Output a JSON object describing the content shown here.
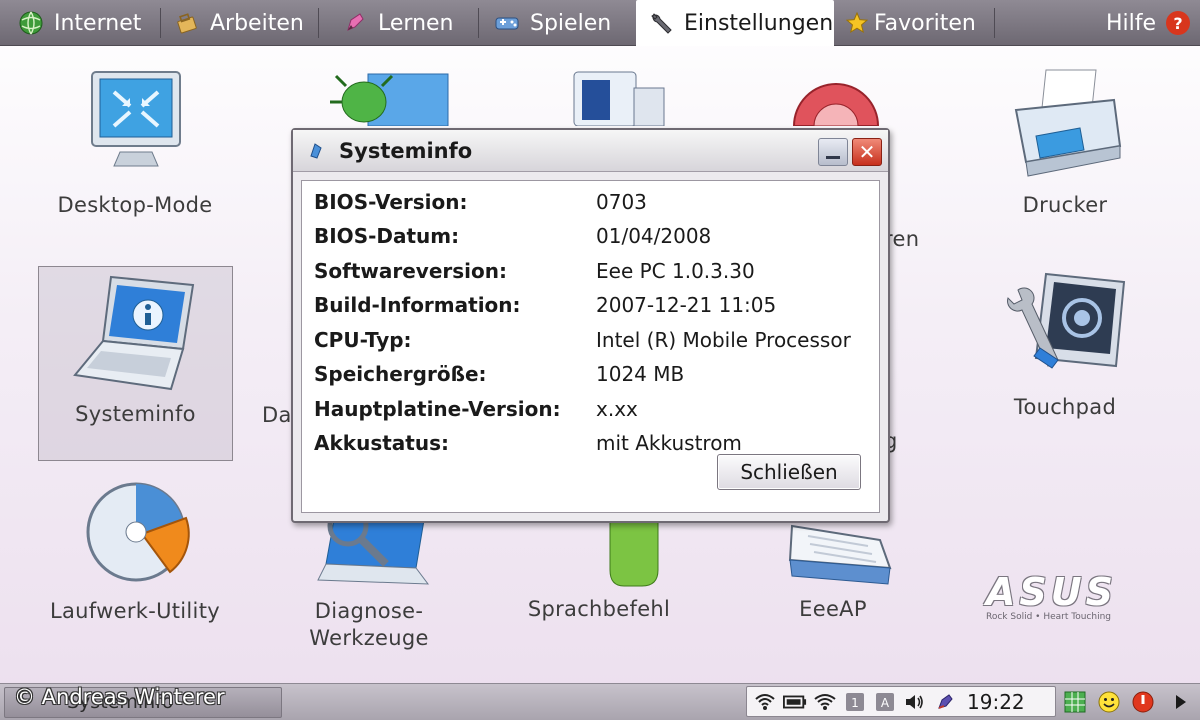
{
  "tabs": [
    {
      "label": "Internet",
      "icon": "globe-icon"
    },
    {
      "label": "Arbeiten",
      "icon": "briefcase-icon"
    },
    {
      "label": "Lernen",
      "icon": "pencil-icon"
    },
    {
      "label": "Spielen",
      "icon": "gamepad-icon"
    },
    {
      "label": "Einstellungen",
      "icon": "wrench-icon",
      "active": true
    },
    {
      "label": "Favoriten",
      "icon": "star-icon"
    }
  ],
  "help": {
    "label": "Hilfe"
  },
  "apps": {
    "desktop_mode": "Desktop-Mode",
    "drucker": "Drucker",
    "systeminfo": "Systeminfo",
    "touchpad": "Touchpad",
    "laufwerk": "Laufwerk-Utility",
    "diagnose_1": "Diagnose-",
    "diagnose_2": "Werkzeuge",
    "sprachbefehl": "Sprachbefehl",
    "eeeap": "EeeAP",
    "partial_da": "Da",
    "partial_ren": "ren",
    "partial_g": "g"
  },
  "dialog": {
    "title": "Systeminfo",
    "rows": [
      {
        "key": "BIOS-Version:",
        "value": "0703"
      },
      {
        "key": "BIOS-Datum:",
        "value": "01/04/2008"
      },
      {
        "key": "Softwareversion:",
        "value": "Eee PC 1.0.3.30"
      },
      {
        "key": "Build-Information:",
        "value": "2007-12-21 11:05"
      },
      {
        "key": "CPU-Typ:",
        "value": "Intel (R) Mobile Processor"
      },
      {
        "key": "Speichergröße:",
        "value": "1024 MB"
      },
      {
        "key": "Hauptplatine-Version:",
        "value": "x.xx"
      },
      {
        "key": "Akkustatus:",
        "value": "mit Akkustrom"
      }
    ],
    "close_button": "Schließen"
  },
  "brand": {
    "logo": "ASUS",
    "tagline": "Rock Solid • Heart Touching"
  },
  "taskbar": {
    "item_label": "Systeminfo",
    "watermark": "© Andreas Winterer",
    "clock": "19:22"
  },
  "colors": {
    "accent_blue": "#2f7fd8",
    "close_red": "#c7301d",
    "tab_bar": "#7d7882"
  }
}
